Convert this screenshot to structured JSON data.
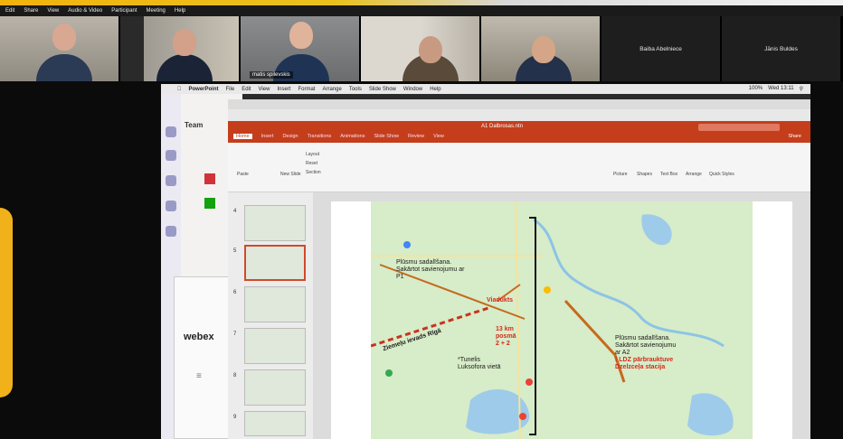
{
  "zoom_menu": [
    "Edit",
    "Share",
    "View",
    "Audio & Video",
    "Participant",
    "Meeting",
    "Help"
  ],
  "participants": [
    {
      "name": ""
    },
    {
      "name": ""
    },
    {
      "name": "matis spilevskis"
    },
    {
      "name": ""
    },
    {
      "name": ""
    },
    {
      "name": "Baiba Abelniece"
    },
    {
      "name": "Jānis Buldes"
    }
  ],
  "mac_menu": [
    "PowerPoint",
    "File",
    "Edit",
    "View",
    "Insert",
    "Format",
    "Arrange",
    "Tools",
    "Slide Show",
    "Window",
    "Help"
  ],
  "mac_clock": "Wed 13:11",
  "mac_battery": "100%",
  "teams_title": "Team",
  "webex_logo": "webex",
  "ppt": {
    "doc_title": "A1 Dalbrosas.ntn",
    "tabs": [
      "Home",
      "Insert",
      "Design",
      "Transitions",
      "Animations",
      "Slide Show",
      "Review",
      "View"
    ],
    "selected_tab": "Home",
    "share_label": "Share",
    "toolbar_groups": [
      "Paste",
      "New Slide",
      "Layout",
      "Reset",
      "Section",
      "Picture",
      "Shapes",
      "Text Box",
      "Arrange",
      "Quick Styles"
    ],
    "thumbnail_numbers": [
      "4",
      "5",
      "6",
      "7",
      "8",
      "9"
    ],
    "selected_thumbnail": "5"
  },
  "slide": {
    "label_p1": "Plūsmu sadalīšana. Sakārtot savienojumu ar P1",
    "label_viadukts": "Viadukts",
    "label_ziemelu": "Ziemeļu ievads Rīgā",
    "label_13km_1": "13 km",
    "label_13km_2": "posmā",
    "label_13km_3": "2 + 2",
    "label_tunelis_1": "*Tunelis",
    "label_tunelis_2": "Luksofora vietā",
    "label_a2_1": "Plūsmu sadalīšana.",
    "label_a2_2": "Sakārtot savienojumu",
    "label_a2_3": "ar A2",
    "label_ldz_1": "! LDZ pārbrauktuve",
    "label_ldz_2": "Dzelzceļa stacija"
  }
}
